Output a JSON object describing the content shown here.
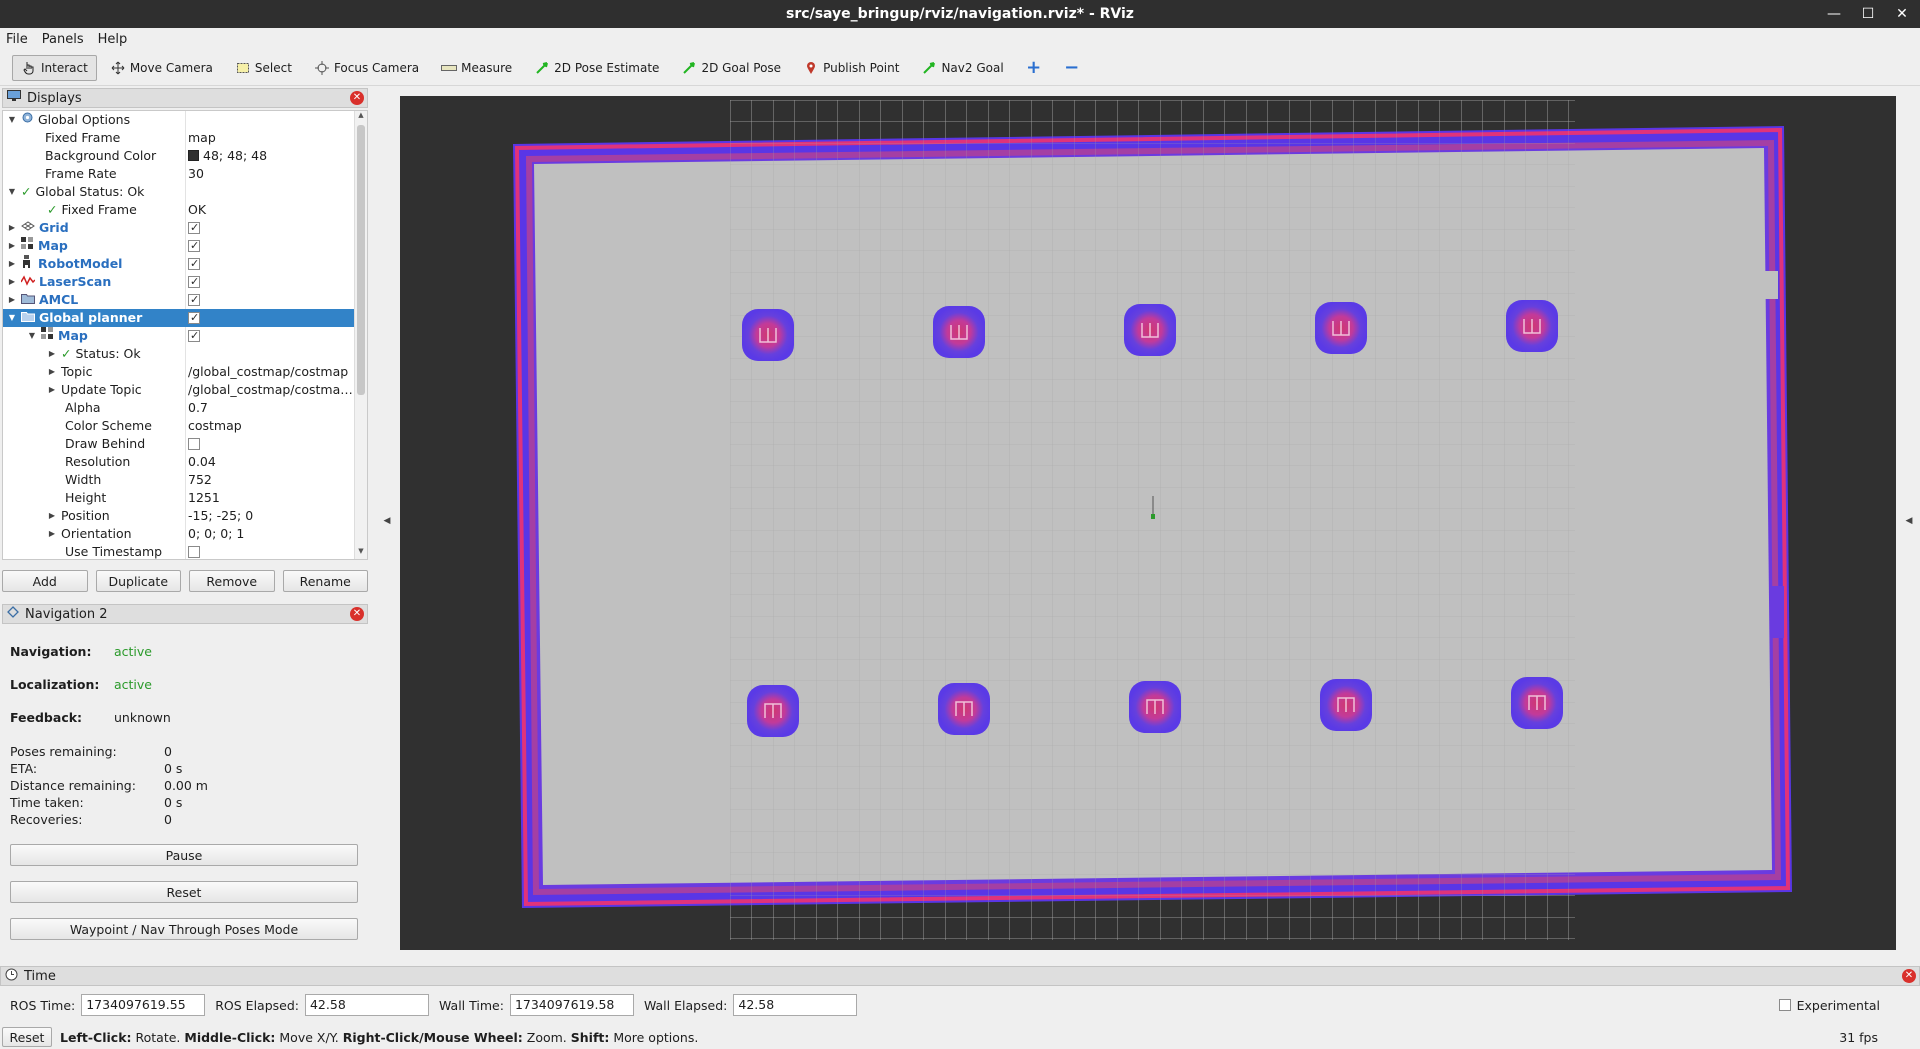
{
  "window": {
    "title": "src/saye_bringup/rviz/navigation.rviz* - RViz"
  },
  "menu": [
    "File",
    "Panels",
    "Help"
  ],
  "toolbar": {
    "interact": "Interact",
    "move_camera": "Move Camera",
    "select": "Select",
    "focus_camera": "Focus Camera",
    "measure": "Measure",
    "pose_estimate": "2D Pose Estimate",
    "goal_pose": "2D Goal Pose",
    "publish_point": "Publish Point",
    "nav2_goal": "Nav2 Goal"
  },
  "displays": {
    "title": "Displays",
    "rows": {
      "global_options": "Global Options",
      "fixed_frame_k": "Fixed Frame",
      "fixed_frame_v": "map",
      "bg_color_k": "Background Color",
      "bg_color_v": "48; 48; 48",
      "frame_rate_k": "Frame Rate",
      "frame_rate_v": "30",
      "global_status": "Global Status: Ok",
      "status_fixed_frame_k": "Fixed Frame",
      "status_fixed_frame_v": "OK",
      "grid": "Grid",
      "map": "Map",
      "robot_model": "RobotModel",
      "laser_scan": "LaserScan",
      "amcl": "AMCL",
      "global_planner": "Global planner",
      "gp_map": "Map",
      "gp_status": "Status: Ok",
      "topic_k": "Topic",
      "topic_v": "/global_costmap/costmap",
      "update_topic_k": "Update Topic",
      "update_topic_v": "/global_costmap/costmap_...",
      "alpha_k": "Alpha",
      "alpha_v": "0.7",
      "color_scheme_k": "Color Scheme",
      "color_scheme_v": "costmap",
      "draw_behind_k": "Draw Behind",
      "resolution_k": "Resolution",
      "resolution_v": "0.04",
      "width_k": "Width",
      "width_v": "752",
      "height_k": "Height",
      "height_v": "1251",
      "position_k": "Position",
      "position_v": "-15; -25; 0",
      "orientation_k": "Orientation",
      "orientation_v": "0; 0; 0; 1",
      "use_timestamp_k": "Use Timestamp"
    },
    "buttons": [
      "Add",
      "Duplicate",
      "Remove",
      "Rename"
    ]
  },
  "navigation": {
    "title": "Navigation 2",
    "navigation_k": "Navigation:",
    "navigation_v": "active",
    "localization_k": "Localization:",
    "localization_v": "active",
    "feedback_k": "Feedback:",
    "feedback_v": "unknown",
    "poses_k": "Poses remaining:",
    "poses_v": "0",
    "eta_k": "ETA:",
    "eta_v": "0 s",
    "distance_k": "Distance remaining:",
    "distance_v": "0.00 m",
    "time_k": "Time taken:",
    "time_v": "0 s",
    "recoveries_k": "Recoveries:",
    "recoveries_v": "0",
    "pause": "Pause",
    "reset": "Reset",
    "waypoint": "Waypoint / Nav Through Poses Mode"
  },
  "time": {
    "title": "Time",
    "ros_time_k": "ROS Time:",
    "ros_time_v": "1734097619.55",
    "ros_elapsed_k": "ROS Elapsed:",
    "ros_elapsed_v": "42.58",
    "wall_time_k": "Wall Time:",
    "wall_time_v": "1734097619.58",
    "wall_elapsed_k": "Wall Elapsed:",
    "wall_elapsed_v": "42.58",
    "experimental": "Experimental"
  },
  "status": {
    "reset": "Reset",
    "left_click_b": "Left-Click:",
    "left_click": " Rotate. ",
    "middle_click_b": "Middle-Click:",
    "middle_click": " Move X/Y. ",
    "right_click_b": "Right-Click/Mouse Wheel:",
    "right_click": " Zoom. ",
    "shift_b": "Shift:",
    "shift": " More options.",
    "fps": "31 fps"
  },
  "colors": {
    "viewport_bg": "#303030",
    "map_free": "#c0c0c0",
    "costmap_lethal": "#e0337a",
    "costmap_inflation": "#6a3be0",
    "selection": "#3283c8",
    "status_ok": "#2b9a2b"
  }
}
